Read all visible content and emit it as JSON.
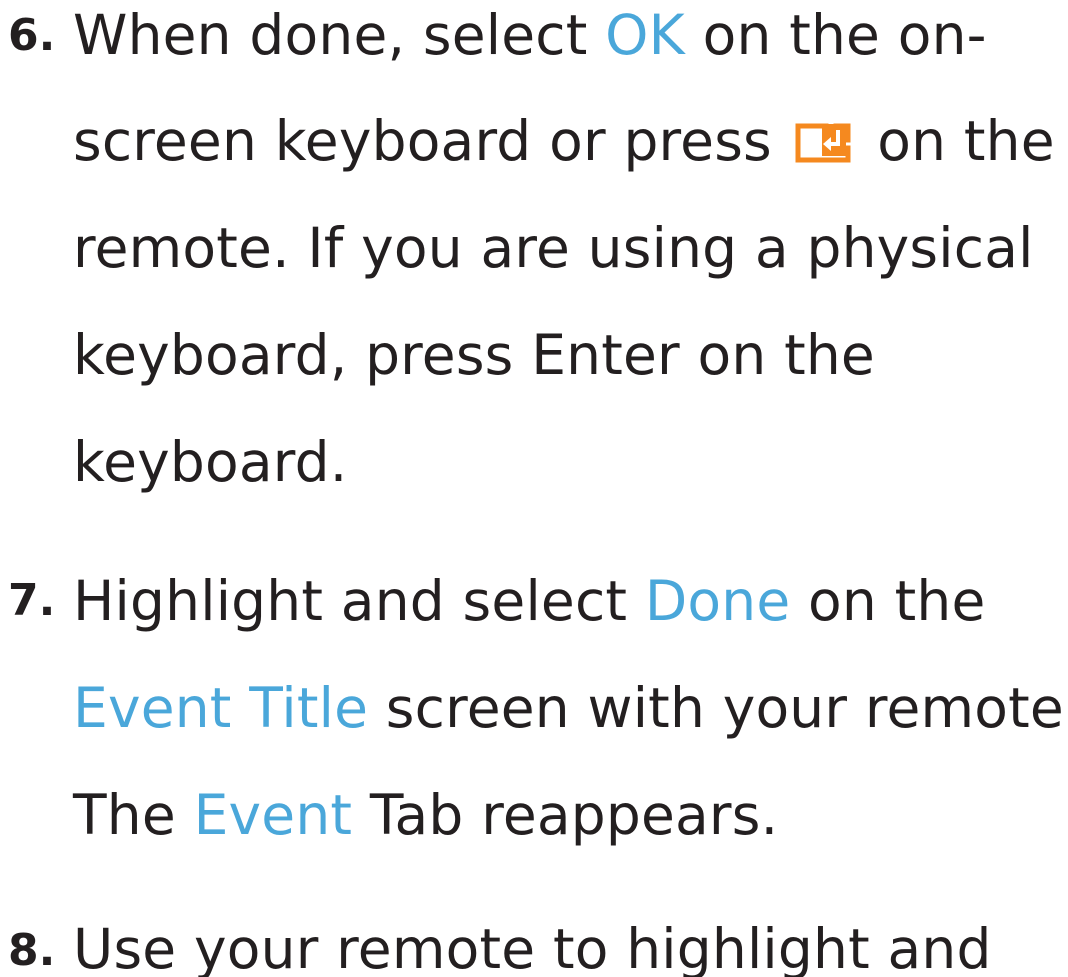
{
  "steps": [
    {
      "number": "6.",
      "lines": [
        [
          {
            "text": "When done, select "
          },
          {
            "text": "OK",
            "highlight": true
          },
          {
            "text": " on the on-"
          }
        ],
        [
          {
            "text": "screen keyboard or press "
          },
          {
            "icon": "enter-key-icon"
          },
          {
            "text": " on the"
          }
        ],
        [
          {
            "text": "remote. If you are using a physical"
          }
        ],
        [
          {
            "text": "keyboard, press Enter on the"
          }
        ],
        [
          {
            "text": "keyboard."
          }
        ]
      ]
    },
    {
      "number": "7.",
      "lines": [
        [
          {
            "text": "Highlight and select "
          },
          {
            "text": "Done",
            "highlight": true
          },
          {
            "text": " on the"
          }
        ],
        [
          {
            "text": "Event Title",
            "highlight": true
          },
          {
            "text": " screen with your remote."
          }
        ],
        [
          {
            "text": "The "
          },
          {
            "text": "Event",
            "highlight": true
          },
          {
            "text": " Tab reappears."
          }
        ]
      ]
    },
    {
      "number": "8.",
      "lines": [
        [
          {
            "text": "Use your remote to highlight and"
          }
        ]
      ]
    }
  ],
  "colors": {
    "text": "#231f20",
    "highlight": "#4aa7da",
    "icon": "#f5891f"
  }
}
